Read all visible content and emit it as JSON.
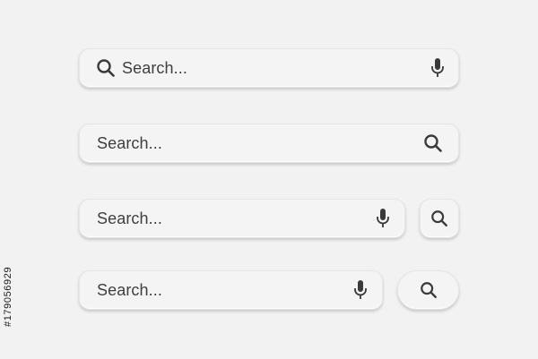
{
  "search_bars": [
    {
      "placeholder": "Search...",
      "leading_icon": "search-icon",
      "trailing_icon": "microphone-icon"
    },
    {
      "placeholder": "Search...",
      "trailing_icon": "search-icon"
    },
    {
      "placeholder": "Search...",
      "trailing_icon": "microphone-icon",
      "separate_button_icon": "search-icon"
    },
    {
      "placeholder": "Search...",
      "trailing_icon": "microphone-icon",
      "separate_button_icon": "search-icon"
    }
  ],
  "side_text": "#179056929",
  "colors": {
    "background": "#f2f2f2",
    "bar": "#f4f4f4",
    "text": "#3e3e3e",
    "icon": "#3a3a3a"
  }
}
